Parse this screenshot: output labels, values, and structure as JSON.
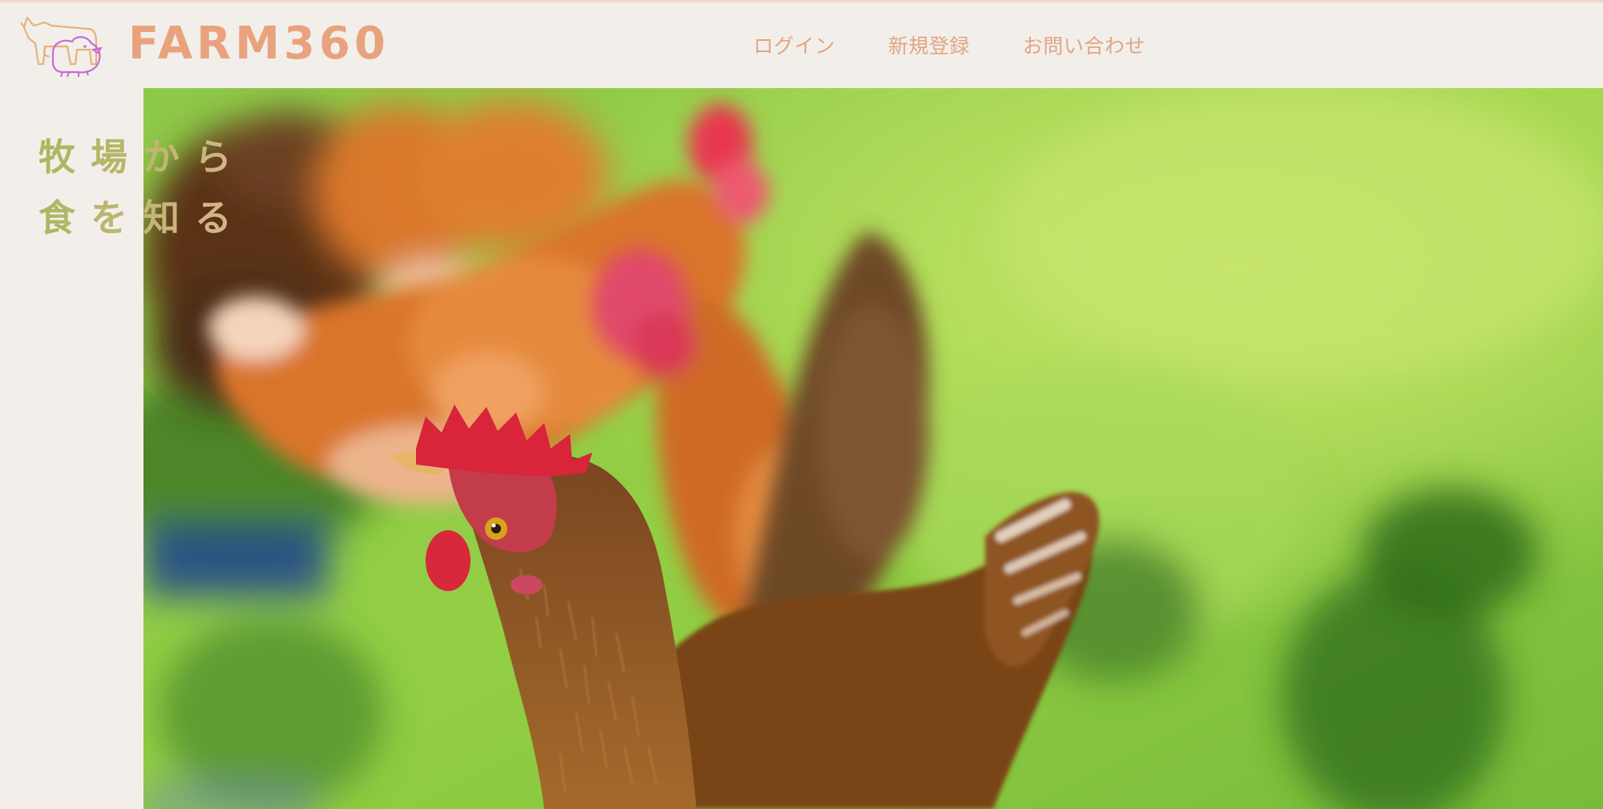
{
  "brand": {
    "name": "FARM360",
    "text_color": "#e8a37e",
    "logo_icon": "farm-animals-logo-icon"
  },
  "nav": {
    "login": "ログイン",
    "signup": "新規登録",
    "contact": "お問い合わせ"
  },
  "hero": {
    "tagline_line1": "牧場から",
    "tagline_line2": "食を知る",
    "tagline_colors": [
      "#a9b85f",
      "#c7b47a",
      "#d8b58f"
    ],
    "image_subject": "chickens-on-grass"
  },
  "colors": {
    "background": "#f2efeb",
    "nav_text": "#e2a582",
    "grass": "#7fc23f",
    "comb": "#d42a3a"
  }
}
